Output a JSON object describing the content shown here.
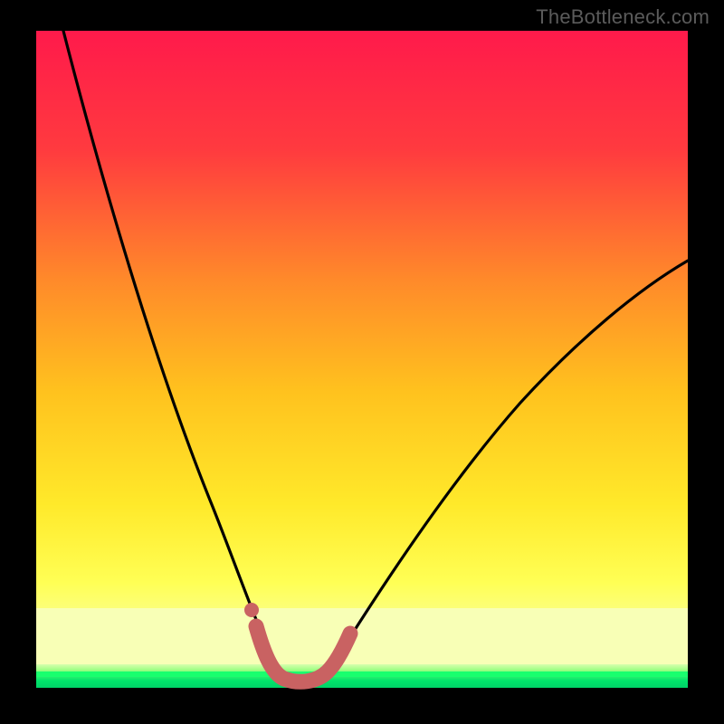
{
  "watermark": "TheBottleneck.com",
  "colors": {
    "black": "#000000",
    "gradient_top": "#ff1a4b",
    "gradient_mid_upper": "#ff7a2e",
    "gradient_mid": "#ffd400",
    "gradient_lower": "#ffff6a",
    "gradient_pale": "#f6ffb0",
    "green_outer": "#8dff7a",
    "green_core": "#00e46a",
    "curve": "#000000",
    "marker": "#c96262",
    "marker_dot": "#c96262"
  },
  "chart_data": {
    "type": "line",
    "title": "",
    "xlabel": "",
    "ylabel": "",
    "xlim": [
      0,
      100
    ],
    "ylim": [
      0,
      100
    ],
    "grid": false,
    "legend": null,
    "annotations": [
      "TheBottleneck.com"
    ],
    "series": [
      {
        "name": "bottleneck-curve",
        "x": [
          4,
          8,
          12,
          16,
          20,
          24,
          28,
          30,
          32,
          34,
          36,
          38,
          40,
          44,
          48,
          52,
          56,
          60,
          66,
          72,
          78,
          84,
          90,
          96,
          100
        ],
        "y": [
          100,
          87,
          74,
          62,
          50,
          39,
          27,
          22,
          16,
          10,
          5,
          2,
          1,
          1,
          4,
          10,
          17,
          24,
          33,
          41,
          47,
          53,
          58,
          62,
          64
        ]
      },
      {
        "name": "optimal-band-marker",
        "x": [
          33,
          35,
          37,
          39,
          41,
          43,
          45
        ],
        "y": [
          8,
          3,
          1,
          0.5,
          0.7,
          2,
          5
        ]
      }
    ],
    "optimum_x": 40,
    "marker_dot": {
      "x": 32.5,
      "y": 10
    }
  }
}
